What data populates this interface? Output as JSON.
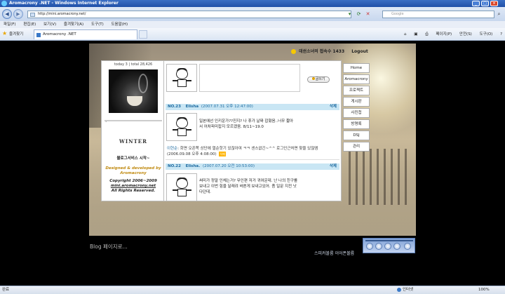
{
  "window": {
    "title": "Aromacrony .NET - Windows Internet Explorer"
  },
  "address": {
    "url": "http://mini.aromacrony.net/",
    "search_placeholder": "Google"
  },
  "menu": {
    "items": [
      "파일(F)",
      "편집(E)",
      "보기(V)",
      "즐겨찾기(A)",
      "도구(T)",
      "도움말(H)"
    ]
  },
  "favbar": {
    "favorites": "즐겨찾기",
    "tab_title": "Aromacrony .NET",
    "page": "페이지(P)",
    "safety": "안전(S)",
    "tools": "도구(O)"
  },
  "blog": {
    "top_info": "데쉰소녀의 접속수 1433",
    "logout": "Logout",
    "counter": "today 3 | total 28,426",
    "season": "WINTER",
    "service_start": "블로그서비스 시작~",
    "designed_1": "Designed & developed by",
    "designed_2": "Aromacrony",
    "copyright_1": "Copyright 2006~2009",
    "copyright_2": "mini.aromacrony.net",
    "copyright_3": "All Rights Reserved.",
    "write_button": "글쓰기",
    "posts": [
      {
        "num": "NO.23",
        "author": "Elisha",
        "date": "(2007.07.31 오후 12:47:00)",
        "delete": "삭제",
        "body_1": "일본에선 인키운가??진지? 나 휴가 날짜 잡혔음..너무 짧아",
        "body_2": "서 어차피미잡지 모르겠음. 8/11~19.0",
        "reply_name": "이현순",
        "reply_text": "회면 오픈쪽 상단에 열순핫기 있잖아여 ㅋㅋ 센스없긴~^^ 로그인근처면 찾을 있잖앰",
        "reply_date": "(2006.09.08 오후 4:08:00)",
        "reply_badge": "삭제"
      },
      {
        "num": "NO.22",
        "author": "Elisha.",
        "date": "(2007.07.20 오전 10:53:00)",
        "delete": "삭제",
        "body_1": "써미가 정말 인체는거? 무인편 저거 귀여운데. 난 나의 친구를",
        "body_2": "보내고 이번 힘을 달래려 바쁜게 보내고있어. 좀 일문 지전 낫",
        "body_3": "다던데."
      }
    ],
    "nav": [
      "Home",
      "Aromacrony",
      "프로젝트",
      "게시판",
      "사진첩",
      "방명록",
      "DSJ",
      "관리"
    ]
  },
  "footer": {
    "blog_label": "Blog 페이지로...",
    "right_label": "스피커볼륨 이어폰볼륨"
  },
  "status": {
    "left": "완료",
    "zone": "인터넷",
    "zoom": "100%"
  }
}
